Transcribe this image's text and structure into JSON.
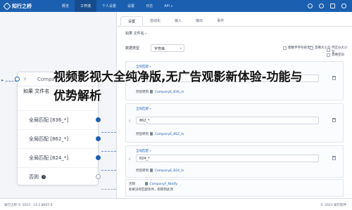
{
  "app": {
    "logo_text": "知行之桥"
  },
  "nav": {
    "items": [
      {
        "label": "概览",
        "active": false
      },
      {
        "label": "工作流",
        "active": true
      },
      {
        "label": "个人设置",
        "active": false
      },
      {
        "label": "设置",
        "active": false
      },
      {
        "label": "日志",
        "active": false
      },
      {
        "label": "API",
        "active": false
      }
    ],
    "api_caret": "▾"
  },
  "canvas": {
    "node": {
      "title": "CompanyF_Match",
      "subheader": "如果 文件名",
      "rows": [
        {
          "label": "全局匹配 [836_*]"
        },
        {
          "label": "全局匹配 [862_*]"
        },
        {
          "label": "全局匹配 [824_*]"
        },
        {
          "label": "否则",
          "info": "i"
        }
      ]
    }
  },
  "panel": {
    "tabs": [
      "设置",
      "自动化",
      "输入",
      "输出",
      "事件"
    ],
    "condition_header": "如果 文件名",
    "field": {
      "label": "数据类型",
      "value": "字符串",
      "checkboxes": [
        "使数字字符串无效",
        "忽略大小写",
        "不区分大小写",
        "忽略空白"
      ]
    },
    "cards": [
      {
        "title": "全局匹配",
        "value": "836_*",
        "route_label": "然后转到",
        "file": "CompanyE_836_In"
      },
      {
        "title": "全局匹配",
        "value": "862_*",
        "route_label": "然后转到",
        "file": "CompanyE_862_In"
      },
      {
        "title": "全局匹配",
        "value": "824_*",
        "route_label": "然后转到",
        "file": "CompanyE_824_In"
      }
    ],
    "else": {
      "label": "否则",
      "file": "CompanyF_Notify",
      "description": "如果没有匹配条件，则转到此项"
    }
  },
  "overlay_text": "视频影视大全纯净版,无广告观影新体验-功能与优势解析",
  "footer": {
    "left": "知行之桥 © 2023 - 23.2.8605.0",
    "right": "© 2023 知行软件"
  }
}
